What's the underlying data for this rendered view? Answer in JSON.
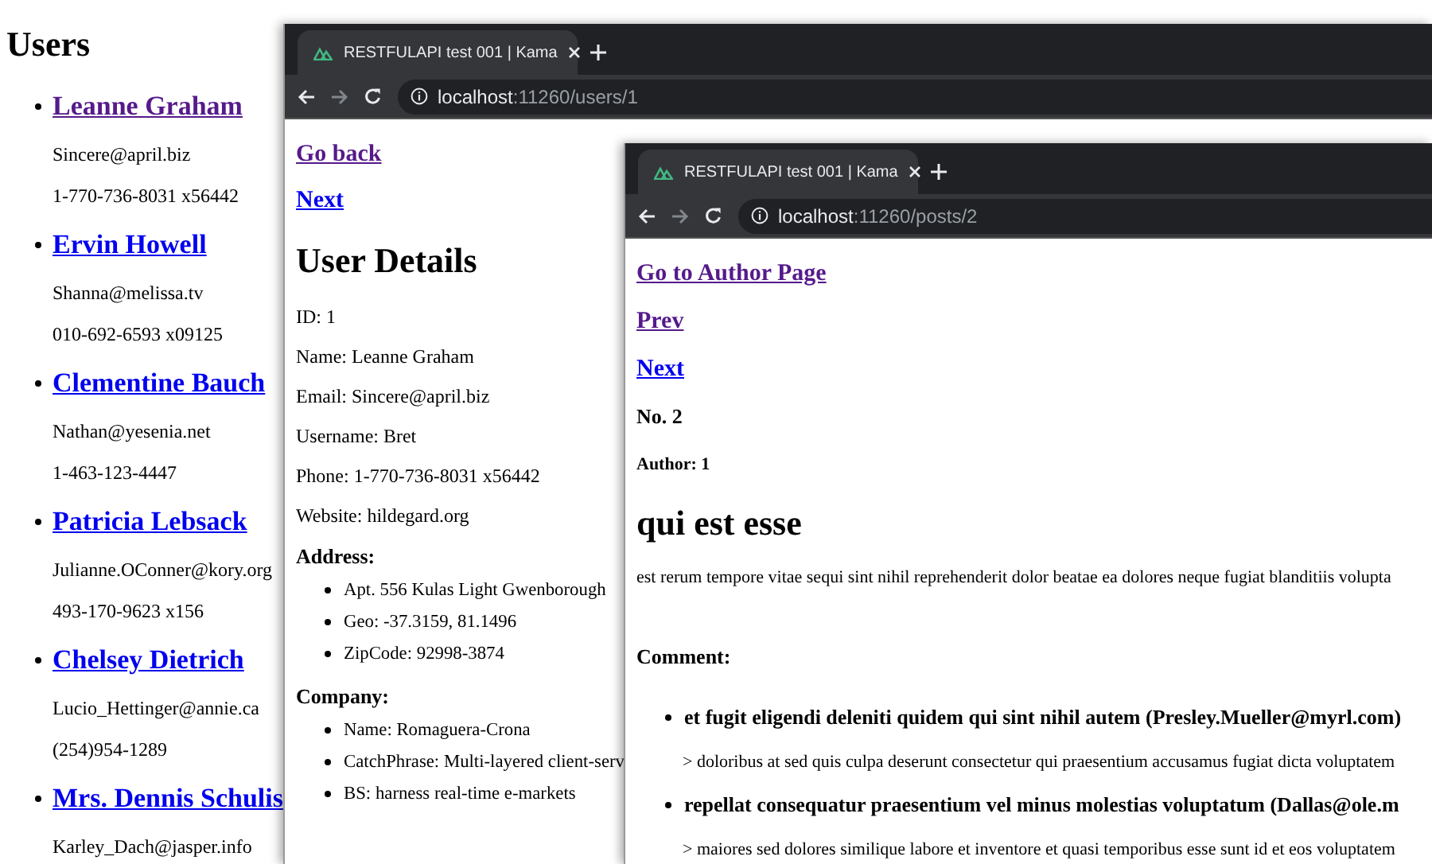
{
  "users_page": {
    "title": "Users",
    "users": [
      {
        "name": "Leanne Graham",
        "visited": true,
        "email": "Sincere@april.biz",
        "phone": "1-770-736-8031 x56442"
      },
      {
        "name": "Ervin Howell",
        "visited": false,
        "email": "Shanna@melissa.tv",
        "phone": "010-692-6593 x09125"
      },
      {
        "name": "Clementine Bauch",
        "visited": false,
        "email": "Nathan@yesenia.net",
        "phone": "1-463-123-4447"
      },
      {
        "name": "Patricia Lebsack",
        "visited": false,
        "email": "Julianne.OConner@kory.org",
        "phone": "493-170-9623 x156"
      },
      {
        "name": "Chelsey Dietrich",
        "visited": false,
        "email": "Lucio_Hettinger@annie.ca",
        "phone": "(254)954-1289"
      },
      {
        "name": "Mrs. Dennis Schulis",
        "visited": false,
        "email": "Karley_Dach@jasper.info"
      }
    ]
  },
  "user_window": {
    "tab": {
      "title": "RESTFULAPI test 001 | Kama"
    },
    "address": {
      "host": "localhost",
      "path": ":11260/users/1"
    },
    "links": [
      {
        "label": "Go back",
        "visited": true
      },
      {
        "label": "Next",
        "visited": false
      }
    ],
    "heading": "User Details",
    "fields": [
      "ID: 1",
      "Name: Leanne Graham",
      "Email: Sincere@april.biz",
      "Username: Bret",
      "Phone: 1-770-736-8031 x56442",
      "Website: hildegard.org"
    ],
    "sections": [
      {
        "heading": "Address:",
        "items": [
          "Apt. 556 Kulas Light Gwenborough",
          "Geo: -37.3159, 81.1496",
          "ZipCode: 92998-3874"
        ]
      },
      {
        "heading": "Company:",
        "items": [
          "Name: Romaguera-Crona",
          "CatchPhrase: Multi-layered client-serv",
          "BS: harness real-time e-markets"
        ]
      }
    ]
  },
  "post_window": {
    "tab": {
      "title": "RESTFULAPI test 001 | Kama"
    },
    "address": {
      "host": "localhost",
      "path": ":11260/posts/2"
    },
    "links": [
      {
        "label": "Go to Author Page",
        "visited": true
      },
      {
        "label": "Prev",
        "visited": true
      },
      {
        "label": "Next",
        "visited": false
      }
    ],
    "number": "No. 2",
    "author": "Author: 1",
    "title": "qui est esse",
    "body": "est rerum tempore vitae sequi sint nihil reprehenderit dolor beatae ea dolores neque fugiat blanditiis volupta",
    "comment_heading": "Comment:",
    "comments": [
      {
        "title": "et fugit eligendi deleniti quidem qui sint nihil autem (Presley.Mueller@myrl.com)",
        "body": "> doloribus at sed quis culpa deserunt consectetur qui praesentium accusamus fugiat dicta voluptatem"
      },
      {
        "title": "repellat consequatur praesentium vel minus molestias voluptatum (Dallas@ole.m",
        "body": "> maiores sed dolores similique labore et inventore et quasi temporibus esse sunt id et eos voluptatem"
      }
    ]
  }
}
